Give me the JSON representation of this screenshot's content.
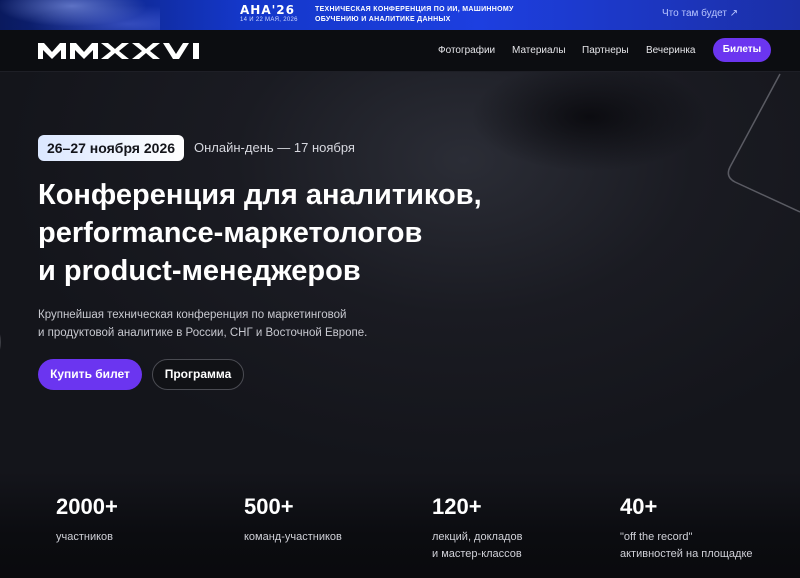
{
  "promo": {
    "logo_text": "АНА'26",
    "dates": "14 И 22 МАЯ, 2026",
    "line1": "ТЕХНИЧЕСКАЯ КОНФЕРЕНЦИЯ ПО ИИ, МАШИННОМУ",
    "line2": "ОБУЧЕНИЮ И АНАЛИТИКЕ ДАННЫХ",
    "link": "Что там будет ↗"
  },
  "nav": {
    "logo": "MMXXVI",
    "links": [
      "Фотографии",
      "Материалы",
      "Партнеры",
      "Вечеринка"
    ],
    "cta": "Билеты"
  },
  "hero": {
    "dates": "26–27 ноября 2026",
    "online_day": "Онлайн-день — 17 ноября",
    "title_lines": [
      "Конференция для аналитиков,",
      "performance-маркетологов",
      "и product-менеджеров"
    ],
    "subtitle_lines": [
      "Крупнейшая техническая конференция по маркетинговой",
      "и продуктовой аналитике в России, СНГ и Восточной Европе."
    ],
    "buy_button": "Купить билет",
    "program_button": "Программа"
  },
  "stats": [
    {
      "value": "2000+",
      "label_lines": [
        "участников"
      ]
    },
    {
      "value": "500+",
      "label_lines": [
        "команд-участников"
      ]
    },
    {
      "value": "120+",
      "label_lines": [
        "лекций, докладов",
        "и мастер-классов"
      ]
    },
    {
      "value": "40+",
      "label_lines": [
        "\"off the record\"",
        "активностей на площадке"
      ]
    }
  ],
  "colors": {
    "accent": "#6b35f0",
    "background": "#14151b",
    "banner": "#1d3fe0"
  }
}
